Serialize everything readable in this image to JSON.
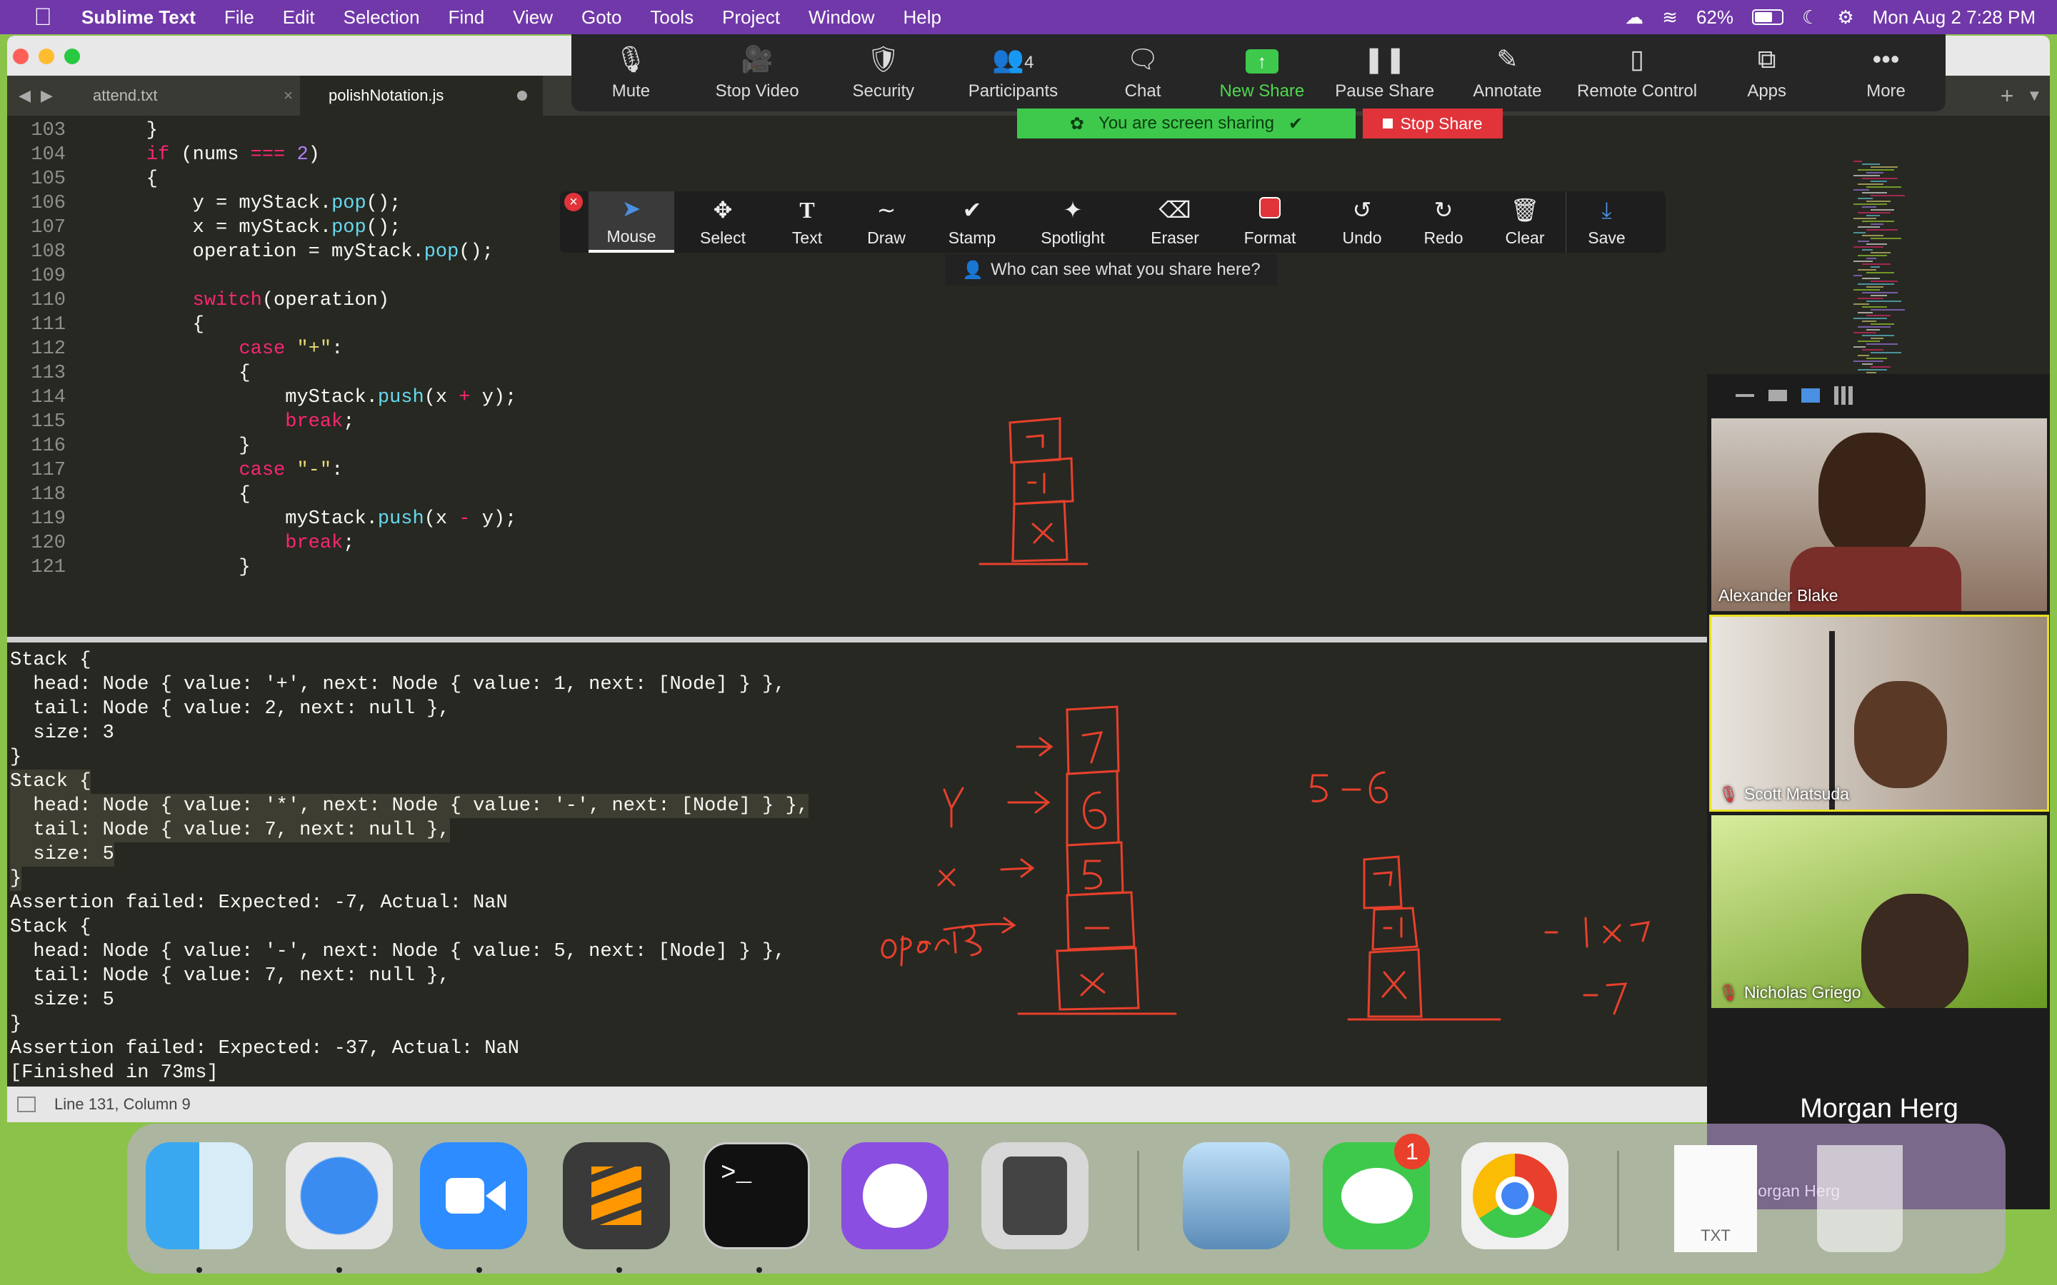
{
  "menubar": {
    "app_name": "Sublime Text",
    "items": [
      "File",
      "Edit",
      "Selection",
      "Find",
      "View",
      "Goto",
      "Tools",
      "Project",
      "Window",
      "Help"
    ],
    "battery": "62%",
    "datetime": "Mon Aug 2  7:28 PM"
  },
  "editor": {
    "tabs": [
      {
        "label": "attend.txt",
        "active": false
      },
      {
        "label": "polishNotation.js",
        "active": true
      }
    ],
    "status": "Line 131, Column 9"
  },
  "code_lines": [
    {
      "n": "103",
      "t": "    }"
    },
    {
      "n": "104",
      "t": "    if (nums === 2)"
    },
    {
      "n": "105",
      "t": "    {"
    },
    {
      "n": "106",
      "t": "        y = myStack.pop();"
    },
    {
      "n": "107",
      "t": "        x = myStack.pop();"
    },
    {
      "n": "108",
      "t": "        operation = myStack.pop();"
    },
    {
      "n": "109",
      "t": ""
    },
    {
      "n": "110",
      "t": "        switch(operation)"
    },
    {
      "n": "111",
      "t": "        {"
    },
    {
      "n": "112",
      "t": "            case \"+\":"
    },
    {
      "n": "113",
      "t": "            {"
    },
    {
      "n": "114",
      "t": "                myStack.push(x + y);"
    },
    {
      "n": "115",
      "t": "                break;"
    },
    {
      "n": "116",
      "t": "            }"
    },
    {
      "n": "117",
      "t": "            case \"-\":"
    },
    {
      "n": "118",
      "t": "            {"
    },
    {
      "n": "119",
      "t": "                myStack.push(x - y);"
    },
    {
      "n": "120",
      "t": "                break;"
    },
    {
      "n": "121",
      "t": "            }"
    }
  ],
  "console_lines": [
    "Stack {",
    "  head: Node { value: '+', next: Node { value: 1, next: [Node] } },",
    "  tail: Node { value: 2, next: null },",
    "  size: 3",
    "}",
    "Stack {",
    "  head: Node { value: '*', next: Node { value: '-', next: [Node] } },",
    "  tail: Node { value: 7, next: null },",
    "  size: 5",
    "}",
    "Assertion failed: Expected: -7, Actual: NaN",
    "Stack {",
    "  head: Node { value: '-', next: Node { value: 5, next: [Node] } },",
    "  tail: Node { value: 7, next: null },",
    "  size: 5",
    "}",
    "Assertion failed: Expected: -37, Actual: NaN",
    "[Finished in 73ms]"
  ],
  "zoom_toolbar": {
    "buttons": [
      {
        "label": "Mute",
        "icon": "microphone-icon"
      },
      {
        "label": "Stop Video",
        "icon": "video-camera-icon"
      },
      {
        "label": "Security",
        "icon": "shield-icon"
      },
      {
        "label": "Participants",
        "icon": "participants-icon",
        "count": "4"
      },
      {
        "label": "Chat",
        "icon": "chat-bubble-icon"
      },
      {
        "label": "New Share",
        "icon": "share-arrow-icon"
      },
      {
        "label": "Pause Share",
        "icon": "pause-icon"
      },
      {
        "label": "Annotate",
        "icon": "pencil-icon"
      },
      {
        "label": "Remote Control",
        "icon": "mouse-icon"
      },
      {
        "label": "Apps",
        "icon": "apps-icon"
      },
      {
        "label": "More",
        "icon": "more-dots-icon"
      }
    ],
    "sharing_banner": "You are screen sharing",
    "stop_share": "Stop Share"
  },
  "annotation_toolbar": {
    "tools": [
      {
        "label": "Mouse",
        "icon": "cursor-icon"
      },
      {
        "label": "Select",
        "icon": "move-arrows-icon"
      },
      {
        "label": "Text",
        "icon": "text-t-icon"
      },
      {
        "label": "Draw",
        "icon": "squiggle-icon"
      },
      {
        "label": "Stamp",
        "icon": "checkmark-icon"
      },
      {
        "label": "Spotlight",
        "icon": "magic-wand-icon"
      },
      {
        "label": "Eraser",
        "icon": "eraser-icon"
      },
      {
        "label": "Format",
        "icon": "red-square-icon"
      },
      {
        "label": "Undo",
        "icon": "undo-icon"
      },
      {
        "label": "Redo",
        "icon": "redo-icon"
      },
      {
        "label": "Clear",
        "icon": "trash-icon"
      },
      {
        "label": "Save",
        "icon": "save-download-icon"
      }
    ],
    "who_can_see": "Who can see what you share here?"
  },
  "whiteboard_notes": {
    "top_stack": [
      "7",
      "-1",
      "x"
    ],
    "big_stack": [
      "7",
      "6",
      "5",
      "-",
      "x"
    ],
    "labels": [
      "y",
      "x",
      "operatis"
    ],
    "expression": "5 -6",
    "small_stack": [
      "7",
      "-1",
      "x"
    ],
    "result_a": "- 1 x 7",
    "result_b": "-7"
  },
  "participants": [
    {
      "name": "Alexander Blake",
      "muted": false,
      "bg": "#a08f80"
    },
    {
      "name": "Scott Matsuda",
      "muted": true,
      "bg": "#8c7d70"
    },
    {
      "name": "Nicholas Griego",
      "muted": true,
      "bg": "#8ab03a"
    },
    {
      "name": "Morgan Herg",
      "muted": true,
      "bg": "#1c1c1c"
    }
  ],
  "dock": {
    "apps": [
      "Finder",
      "Safari",
      "Zoom",
      "Sublime Text",
      "Terminal",
      "GitHub Desktop",
      "Calculator",
      "Preview",
      "Messages",
      "Chrome"
    ],
    "messages_badge": "1",
    "trash_label": "TXT"
  },
  "colors": {
    "annotation_red": "#e8402c",
    "zoom_green": "#3ec94c",
    "stop_red": "#e0333a",
    "menubar_purple": "#7038a8"
  }
}
